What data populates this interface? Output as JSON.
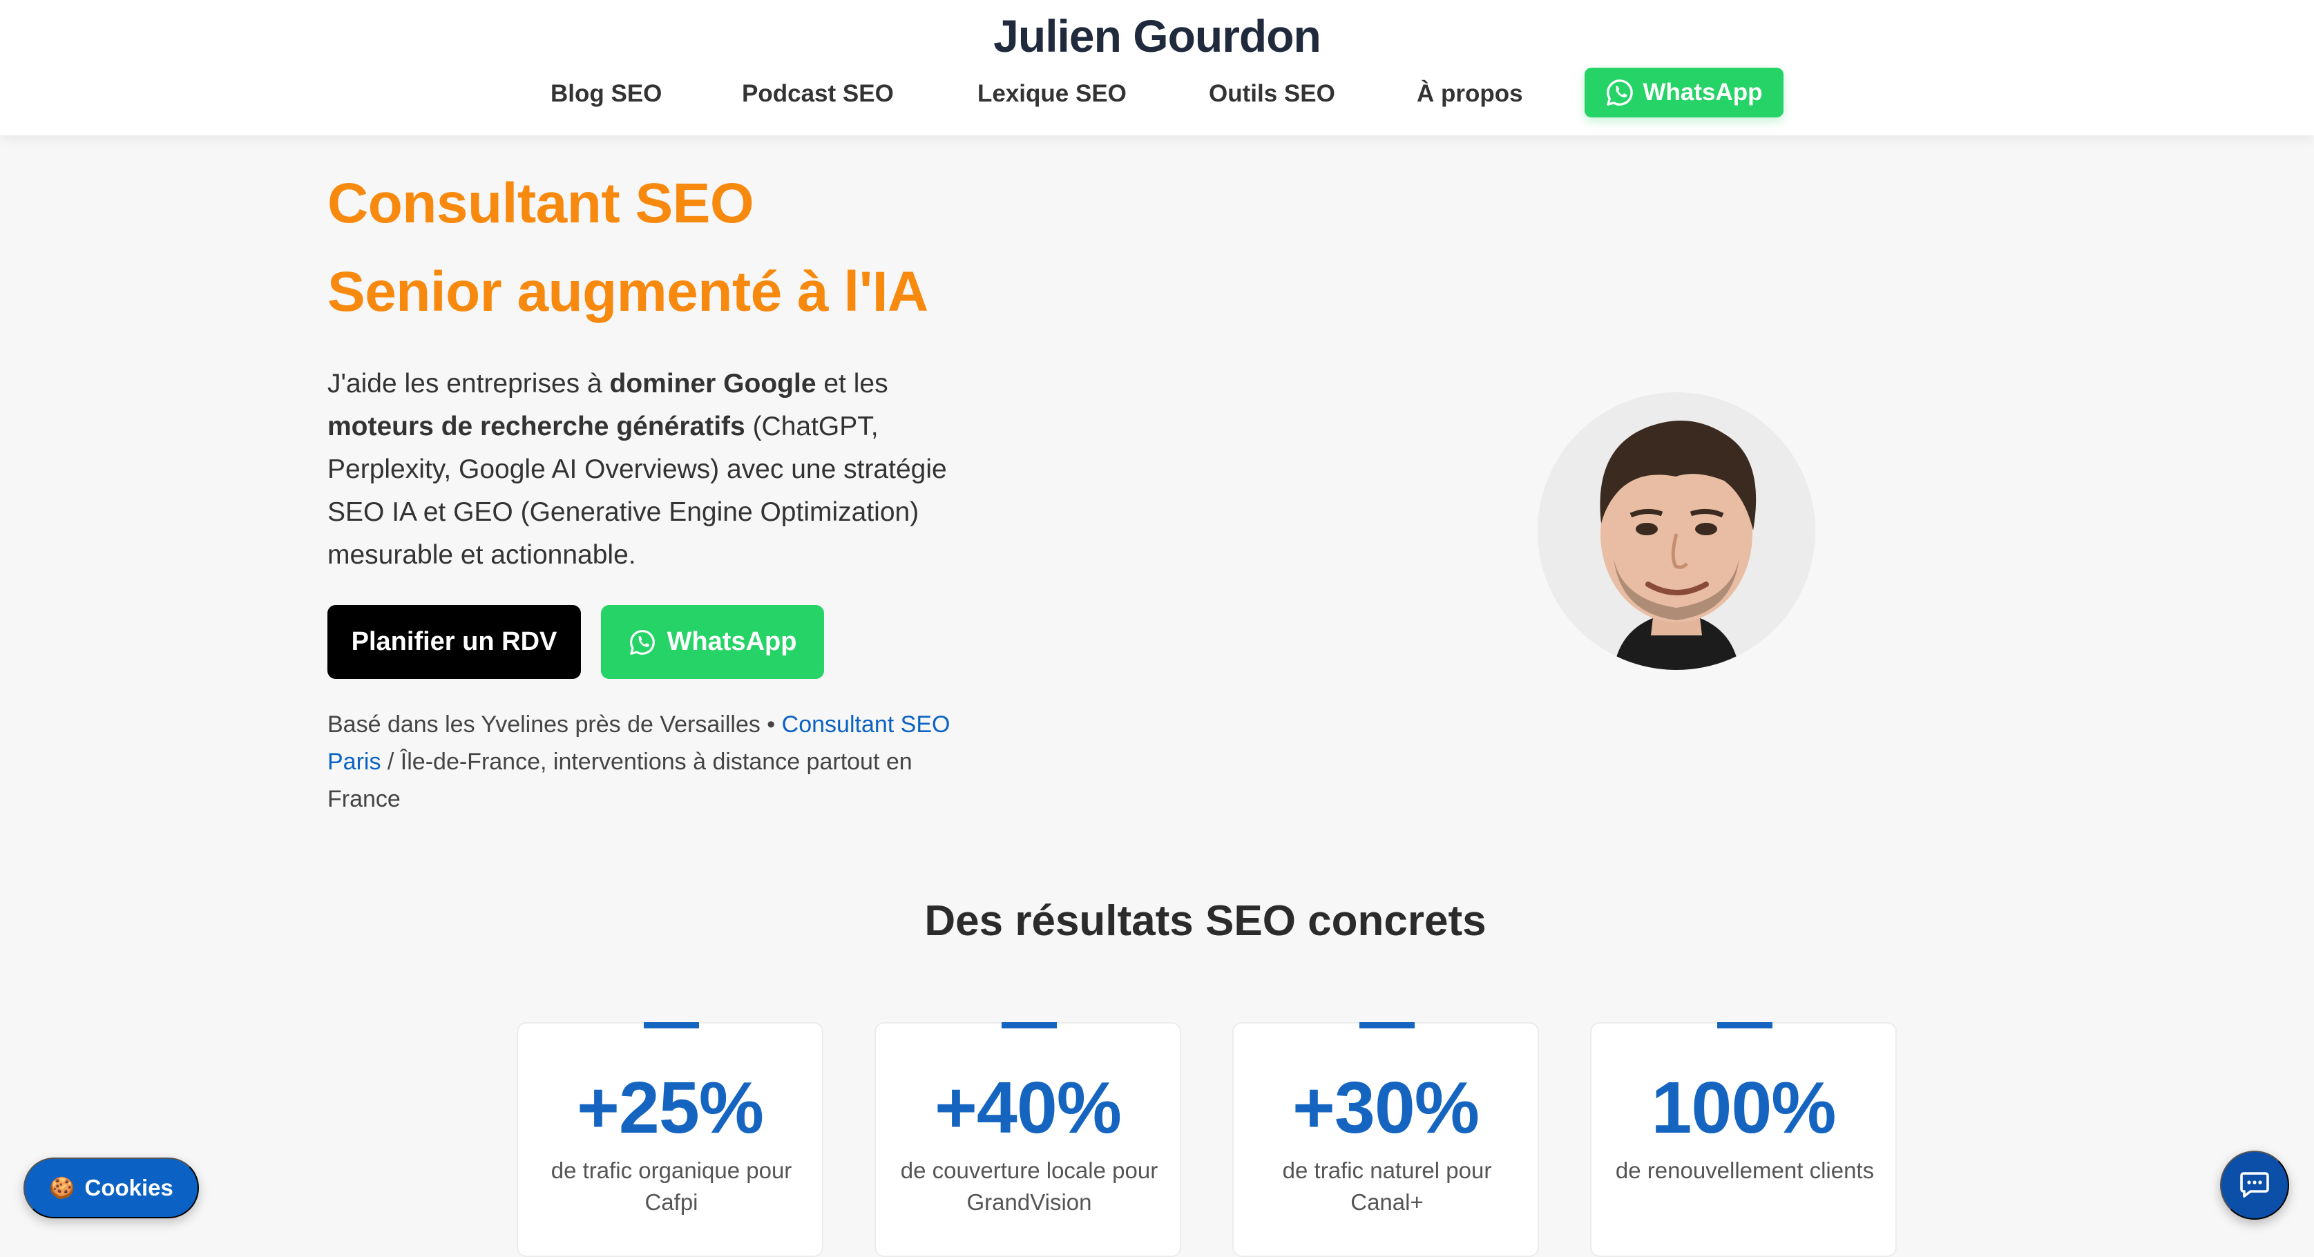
{
  "site": {
    "title": "Julien Gourdon"
  },
  "nav": {
    "items": [
      "Blog SEO",
      "Podcast SEO",
      "Lexique SEO",
      "Outils SEO",
      "À propos"
    ],
    "whatsapp": "WhatsApp"
  },
  "hero": {
    "title_line1": "Consultant SEO",
    "title_line2": "Senior augmenté à l'IA",
    "text": {
      "p1": "J'aide les entreprises à ",
      "b1": "dominer Google",
      "p2": " et les ",
      "b2": "moteurs de recherche génératifs",
      "p3": " (ChatGPT, Perplexity, Google AI Overviews) avec une stratégie SEO IA et GEO (Generative Engine Optimization) mesurable et actionnable."
    },
    "cta_primary": "Planifier un RDV",
    "cta_whatsapp": "WhatsApp",
    "location": {
      "before": "Basé dans les Yvelines près de Versailles • ",
      "link": "Consultant SEO Paris",
      "after": " / Île-de-France, interventions à distance partout en France"
    }
  },
  "results": {
    "title": "Des résultats SEO concrets",
    "stats": [
      {
        "value": "+25%",
        "label": "de trafic organique pour Cafpi"
      },
      {
        "value": "+40%",
        "label": "de couverture locale pour GrandVision"
      },
      {
        "value": "+30%",
        "label": "de trafic naturel pour Canal+"
      },
      {
        "value": "100%",
        "label": "de renouvellement clients"
      }
    ]
  },
  "widgets": {
    "cookies": "Cookies"
  },
  "icons": {
    "whatsapp": "whatsapp-icon",
    "cookie": "cookie-icon",
    "chat": "chat-icon",
    "avatar": "portrait-photo"
  },
  "colors": {
    "accent_orange": "#f7890f",
    "whatsapp_green": "#25d366",
    "stat_blue": "#1565c0",
    "link_blue": "#0b62c4"
  }
}
